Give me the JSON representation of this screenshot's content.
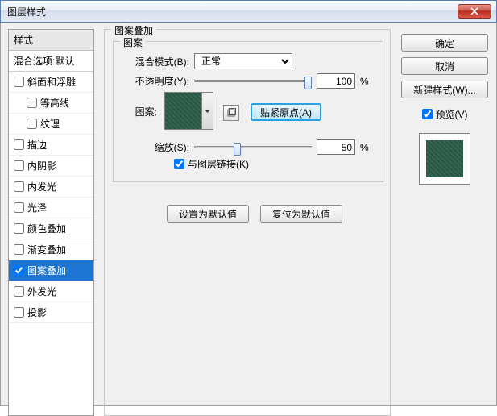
{
  "title": "图层样式",
  "styles_panel": {
    "header": "样式",
    "blend_default": "混合选项:默认",
    "items": [
      {
        "label": "斜面和浮雕",
        "checked": false,
        "indent": false
      },
      {
        "label": "等高线",
        "checked": false,
        "indent": true
      },
      {
        "label": "纹理",
        "checked": false,
        "indent": true
      },
      {
        "label": "描边",
        "checked": false,
        "indent": false
      },
      {
        "label": "内阴影",
        "checked": false,
        "indent": false
      },
      {
        "label": "内发光",
        "checked": false,
        "indent": false
      },
      {
        "label": "光泽",
        "checked": false,
        "indent": false
      },
      {
        "label": "颜色叠加",
        "checked": false,
        "indent": false
      },
      {
        "label": "渐变叠加",
        "checked": false,
        "indent": false
      },
      {
        "label": "图案叠加",
        "checked": true,
        "indent": false,
        "selected": true
      },
      {
        "label": "外发光",
        "checked": false,
        "indent": false
      },
      {
        "label": "投影",
        "checked": false,
        "indent": false
      }
    ]
  },
  "main": {
    "group_label": "图案叠加",
    "inner_label": "图案",
    "blend_mode_label": "混合模式(B):",
    "blend_mode_value": "正常",
    "opacity_label": "不透明度(Y):",
    "opacity_value": "100",
    "percent": "%",
    "pattern_label": "图案:",
    "snap_label": "贴紧原点(A)",
    "scale_label": "缩放(S):",
    "scale_value": "50",
    "link_label": "与图层链接(K)",
    "make_default": "设置为默认值",
    "reset_default": "复位为默认值"
  },
  "right": {
    "ok": "确定",
    "cancel": "取消",
    "new_style": "新建样式(W)...",
    "preview": "预览(V)"
  }
}
